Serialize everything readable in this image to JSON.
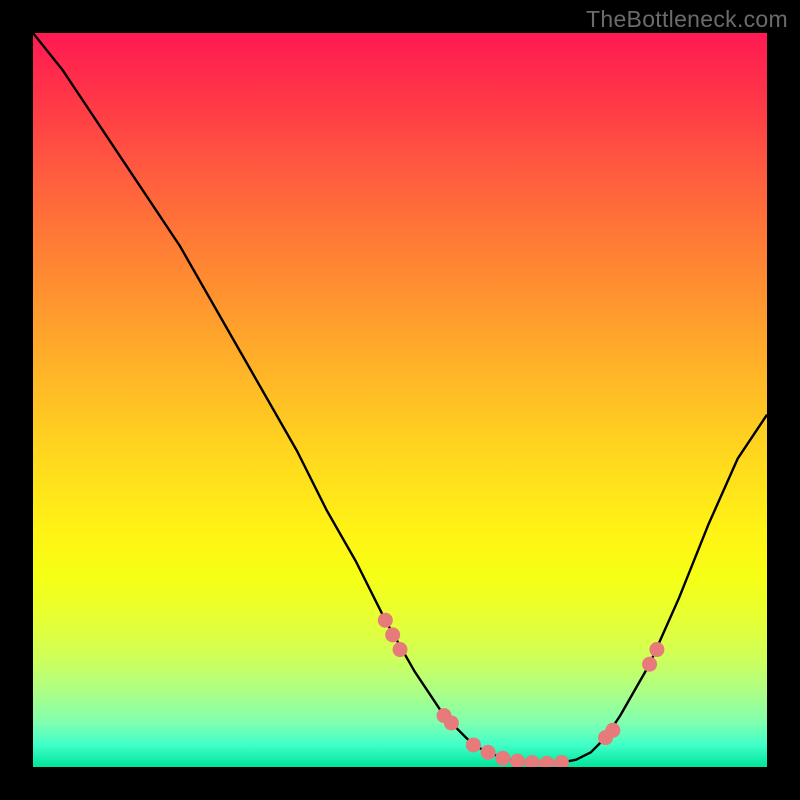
{
  "watermark": "TheBottleneck.com",
  "chart_data": {
    "type": "line",
    "title": "",
    "xlabel": "",
    "ylabel": "",
    "xlim": [
      0,
      100
    ],
    "ylim": [
      0,
      100
    ],
    "series": [
      {
        "name": "curve",
        "x": [
          0,
          4,
          8,
          12,
          16,
          20,
          24,
          28,
          32,
          36,
          40,
          44,
          48,
          52,
          54,
          56,
          58,
          60,
          62,
          64,
          66,
          68,
          70,
          72,
          74,
          76,
          78,
          80,
          84,
          88,
          92,
          96,
          100
        ],
        "y": [
          100,
          95,
          89,
          83,
          77,
          71,
          64,
          57,
          50,
          43,
          35,
          28,
          20,
          13,
          10,
          7,
          5,
          3,
          2,
          1.2,
          0.8,
          0.6,
          0.5,
          0.6,
          1,
          2,
          4,
          7,
          14,
          23,
          33,
          42,
          48
        ]
      }
    ],
    "markers": {
      "name": "highlight-dots",
      "color": "#e77a7a",
      "x": [
        48,
        49,
        50,
        56,
        57,
        60,
        62,
        64,
        66,
        68,
        70,
        72,
        78,
        79,
        84,
        85
      ],
      "y": [
        20,
        18,
        16,
        7,
        6,
        3,
        2,
        1.2,
        0.8,
        0.6,
        0.5,
        0.6,
        4,
        5,
        14,
        16
      ]
    }
  }
}
